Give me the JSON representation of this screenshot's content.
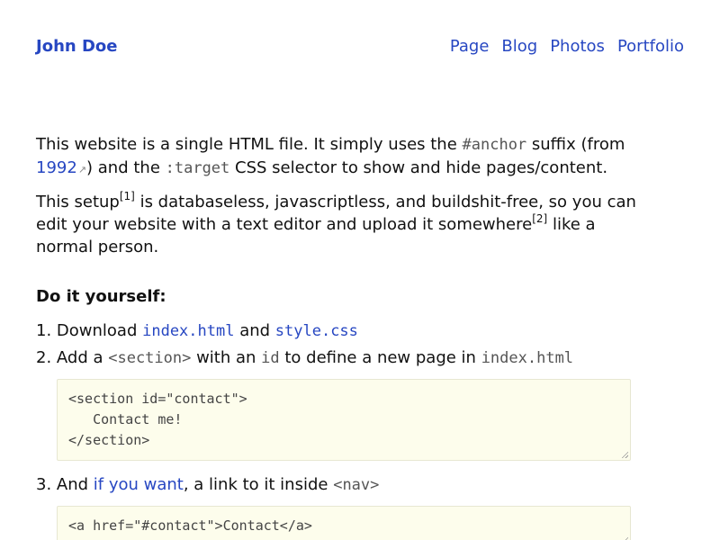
{
  "header": {
    "brand": "John Doe",
    "nav": [
      "Page",
      "Blog",
      "Photos",
      "Portfolio"
    ]
  },
  "intro": {
    "p1_part1": "This website is a single HTML file. It simply uses the ",
    "p1_code1": "#anchor",
    "p1_part2": " suffix (from",
    "p1_link": "1992",
    "p1_part3": ") and the ",
    "p1_code2": ":target",
    "p1_part4": " CSS selector to show and hide pages/content.",
    "p2_part1": "This setup",
    "p2_sup1": "[1]",
    "p2_part2": " is databaseless, javascriptless, and buildshit-free, so you can edit your website with a text editor and upload it somewhere",
    "p2_sup2": "[2]",
    "p2_part3": " like a normal person."
  },
  "diy": {
    "title": "Do it yourself:",
    "step1_num": "1. ",
    "step1_part1": "Download ",
    "step1_link1": "index.html",
    "step1_part2": " and ",
    "step1_link2": "style.css",
    "step2_num": "2. ",
    "step2_part1": "Add a ",
    "step2_code1": "<section>",
    "step2_part2": " with an ",
    "step2_code2": "id",
    "step2_part3": " to define a new page in ",
    "step2_code3": "index.html",
    "code1": "<section id=\"contact\">\n   Contact me!\n</section>",
    "step3_num": "3. ",
    "step3_part1": "And ",
    "step3_link": "if you want",
    "step3_part2": ", a link to it inside ",
    "step3_code": "<nav>",
    "code2": "<a href=\"#contact\">Contact</a>"
  },
  "colors": {
    "link": "#2747c2",
    "code_bg": "#fdfdec",
    "code_text": "#555555"
  }
}
